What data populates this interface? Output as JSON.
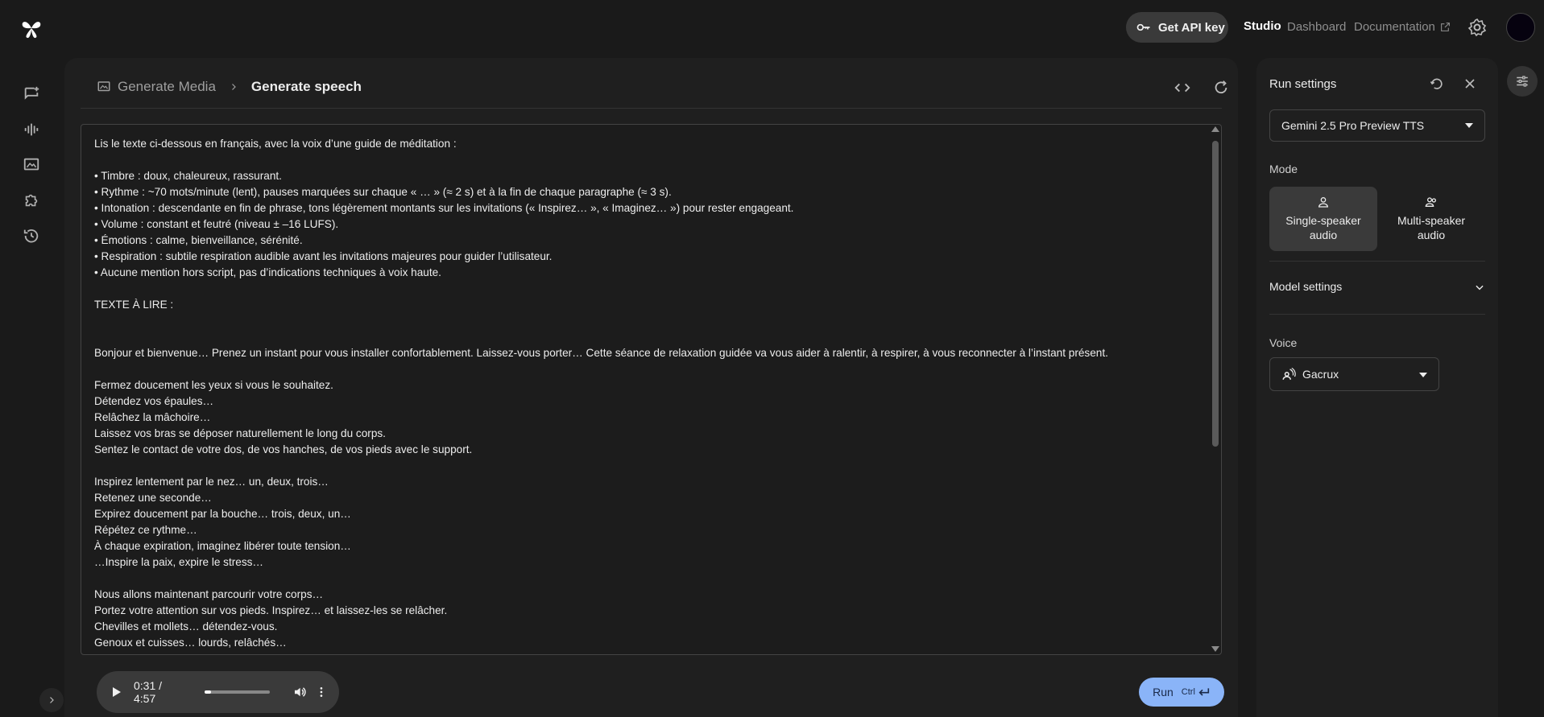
{
  "header": {
    "api_key_label": "Get API key",
    "nav_studio": "Studio",
    "nav_dashboard": "Dashboard",
    "nav_documentation": "Documentation"
  },
  "breadcrumb": {
    "parent": "Generate Media",
    "current": "Generate speech"
  },
  "prompt_text": "Lis le texte ci-dessous en français, avec la voix d’une guide de méditation :\n\n• Timbre : doux, chaleureux, rassurant.\n• Rythme : ~70 mots/minute (lent), pauses marquées sur chaque « … » (≈ 2 s) et à la fin de chaque paragraphe (≈ 3 s).\n• Intonation : descendante en fin de phrase, tons légèrement montants sur les invitations (« Inspirez… », « Imaginez… ») pour rester engageant.\n• Volume : constant et feutré (niveau ± –16 LUFS).\n• Émotions : calme, bienveillance, sérénité.\n• Respiration : subtile respiration audible avant les invitations majeures pour guider l’utilisateur.\n• Aucune mention hors script, pas d’indications techniques à voix haute.\n\nTEXTE À LIRE :\n\n\nBonjour et bienvenue… Prenez un instant pour vous installer confortablement. Laissez-vous porter… Cette séance de relaxation guidée va vous aider à ralentir, à respirer, à vous reconnecter à l’instant présent.\n\nFermez doucement les yeux si vous le souhaitez.\nDétendez vos épaules…\nRelâchez la mâchoire…\nLaissez vos bras se déposer naturellement le long du corps.\nSentez le contact de votre dos, de vos hanches, de vos pieds avec le support.\n\nInspirez lentement par le nez… un, deux, trois…\nRetenez une seconde…\nExpirez doucement par la bouche… trois, deux, un…\nRépétez ce rythme…\nÀ chaque expiration, imaginez libérer toute tension…\n…Inspire la paix, expire le stress…\n\nNous allons maintenant parcourir votre corps…\nPortez votre attention sur vos pieds. Inspirez… et laissez-les se relâcher.\nChevilles et mollets… détendez-vous.\nGenoux et cuisses… lourds, relâchés…",
  "player": {
    "time": "0:31 / 4:57",
    "progress": 0.104
  },
  "run": {
    "label": "Run",
    "shortcut": "Ctrl"
  },
  "settings": {
    "title": "Run settings",
    "model": "Gemini 2.5 Pro Preview TTS",
    "mode_label": "Mode",
    "mode_single": "Single-speaker audio",
    "mode_multi": "Multi-speaker audio",
    "model_settings": "Model settings",
    "voice_label": "Voice",
    "voice": "Gacrux"
  },
  "colors": {
    "accent": "#8ab4f8",
    "background": "#1a1a1a",
    "panel": "#1f1f1f"
  }
}
